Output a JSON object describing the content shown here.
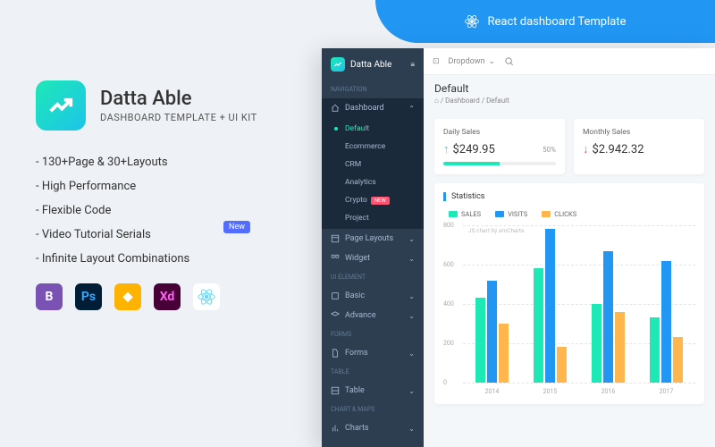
{
  "banner": {
    "label": "React dashboard Template"
  },
  "promo": {
    "brand": "Datta Able",
    "subtitle": "DASHBOARD TEMPLATE + UI KIT",
    "features": [
      "- 130+Page & 30+Layouts",
      "- High Performance",
      "- Flexible Code",
      "- Video Tutorial Serials",
      "- Infinite Layout Combinations"
    ],
    "new_badge": "New",
    "tech": [
      "B",
      "Ps",
      "Sk",
      "Xd",
      "React"
    ]
  },
  "sidebar": {
    "brand": "Datta Able",
    "sections": {
      "nav": "NAVIGATION",
      "ui": "UI ELEMENT",
      "forms": "FORMS",
      "table": "TABLE",
      "charts": "CHART & MAPS"
    },
    "dashboard": {
      "label": "Dashboard",
      "items": [
        "Default",
        "Ecommerce",
        "CRM",
        "Analytics",
        "Crypto",
        "Project"
      ],
      "crypto_tag": "NEW"
    },
    "items": {
      "page_layouts": "Page Layouts",
      "widget": "Widget",
      "basic": "Basic",
      "advance": "Advance",
      "forms": "Forms",
      "table": "Table",
      "charts": "Charts"
    }
  },
  "topbar": {
    "dropdown": "Dropdown"
  },
  "page": {
    "title": "Default",
    "crumb_home": "⌂",
    "crumb_a": "Dashboard",
    "crumb_b": "Default"
  },
  "cards": {
    "daily": {
      "title": "Daily Sales",
      "value": "$249.95",
      "pct": "50%",
      "bar": 50,
      "color": "#1de9b6"
    },
    "monthly": {
      "title": "Monthly Sales",
      "value": "$2.942.32"
    }
  },
  "stats": {
    "title": "Statistics",
    "legend": [
      {
        "name": "SALES",
        "color": "#1de9b6"
      },
      {
        "name": "VISITS",
        "color": "#2196f3"
      },
      {
        "name": "CLICKS",
        "color": "#ffb74d"
      }
    ]
  },
  "chart_data": {
    "type": "bar",
    "credit": "JS chart by amCharts",
    "categories": [
      "2014",
      "2015",
      "2016",
      "2017"
    ],
    "series": [
      {
        "name": "SALES",
        "color": "#1de9b6",
        "values": [
          430,
          580,
          400,
          330
        ]
      },
      {
        "name": "VISITS",
        "color": "#2196f3",
        "values": [
          520,
          780,
          670,
          620
        ]
      },
      {
        "name": "CLICKS",
        "color": "#ffb74d",
        "values": [
          300,
          180,
          360,
          230
        ]
      }
    ],
    "ylim": [
      0,
      800
    ],
    "yticks": [
      0,
      200,
      400,
      600,
      800
    ]
  }
}
